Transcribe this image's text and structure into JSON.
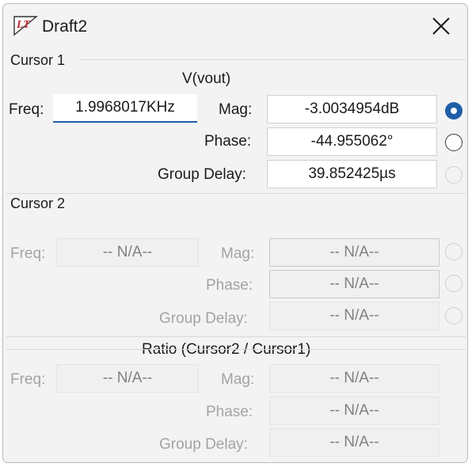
{
  "window": {
    "title": "Draft2",
    "app_icon": "ltspice-logo-icon",
    "close_icon": "close-icon"
  },
  "cursor1": {
    "section_label": "Cursor 1",
    "trace": "V(vout)",
    "freq_label": "Freq:",
    "freq_value": "1.9968017KHz",
    "mag_label": "Mag:",
    "mag_value": "-3.0034954dB",
    "phase_label": "Phase:",
    "phase_value": "-44.955062°",
    "gd_label": "Group Delay:",
    "gd_value": "39.852425µs",
    "selected_radio": "mag"
  },
  "cursor2": {
    "section_label": "Cursor 2",
    "freq_label": "Freq:",
    "freq_value": "-- N/A--",
    "mag_label": "Mag:",
    "mag_value": "-- N/A--",
    "phase_label": "Phase:",
    "phase_value": "-- N/A--",
    "gd_label": "Group Delay:",
    "gd_value": "-- N/A--"
  },
  "ratio": {
    "title": "Ratio (Cursor2 / Cursor1)",
    "freq_label": "Freq:",
    "freq_value": "-- N/A--",
    "mag_label": "Mag:",
    "mag_value": "-- N/A--",
    "phase_label": "Phase:",
    "phase_value": "-- N/A--",
    "gd_label": "Group Delay:",
    "gd_value": "-- N/A--"
  },
  "colors": {
    "accent": "#1f5fa8",
    "background": "#f3f3f3",
    "disabled_text": "#a3a3a3"
  }
}
